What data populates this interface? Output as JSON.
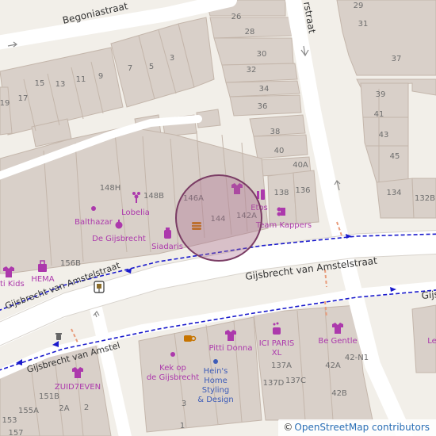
{
  "map": {
    "streets": {
      "begonia": "Begoniastraat",
      "gijsbrecht_upper": "Gijsbrecht van Amstelstraat",
      "gijsbrecht_main": "Gijsbrecht van Amstelstraat",
      "gijsbrecht_lower": "Gijsbrecht van Amstel",
      "vertical_partial": "rstraat",
      "right_partial": "Gijs"
    },
    "house_numbers": {
      "n29": "29",
      "n31": "31",
      "n37": "37",
      "n39": "39",
      "n41": "41",
      "n43": "43",
      "n45": "45",
      "n134": "134",
      "n132B": "132B",
      "n26": "26",
      "n28": "28",
      "n30": "30",
      "n32": "32",
      "n34": "34",
      "n36": "36",
      "n38": "38",
      "n40": "40",
      "n40A": "40A",
      "n136": "136",
      "n138": "138",
      "n7": "7",
      "n5": "5",
      "n3": "3",
      "n15": "15",
      "n13": "13",
      "n11": "11",
      "n9": "9",
      "n19": "19",
      "n17": "17",
      "n148H": "148H",
      "n148B": "148B",
      "n146A": "146A",
      "n144": "144",
      "n142A": "142A",
      "n156B": "156B",
      "n137A": "137A",
      "n137D": "137D",
      "n137C": "137C",
      "n42A": "42A",
      "n42N1": "42-N1",
      "n42B": "42B",
      "n151B": "151B",
      "n155A": "155A",
      "n2A": "2A",
      "n2": "2",
      "n1": "1",
      "n3b": "3",
      "n157": "157",
      "n153": "153"
    },
    "pois": {
      "balthazar": "Balthazar",
      "lobelia": "Lobelia",
      "gijsbrecht": "De Gijsbrecht",
      "siadaris": "Siadaris",
      "etos": "Etos",
      "team_kappers": "Team Kappers",
      "pitti_kids": "itti Kids",
      "hema": "HEMA",
      "zuid7even": "ZUID7EVEN",
      "kek_line1": "Kek op",
      "kek_line2": "de Gijsbrecht",
      "pitti_donna": "Pitti Donna",
      "hein_line1": "Hein's",
      "hein_line2": "Home",
      "hein_line3": "Styling",
      "hein_line4": "& Design",
      "ici_line1": "ICI PARIS",
      "ici_line2": "XL",
      "be_gentle": "Be Gentle",
      "le_partial": "Le"
    },
    "attribution": {
      "copyright": "©",
      "text": "OpenStreetMap contributors"
    },
    "colors": {
      "background": "#f2efe9",
      "building": "#d9d0c9",
      "building_stroke": "#c4b6ab",
      "road": "#ffffff",
      "bus_route": "#1a1acc",
      "poi": "#ac39ac",
      "poi_brown": "#c77400",
      "marker_fill": "#a86a8c",
      "marker_stroke": "#7a3c64"
    }
  }
}
